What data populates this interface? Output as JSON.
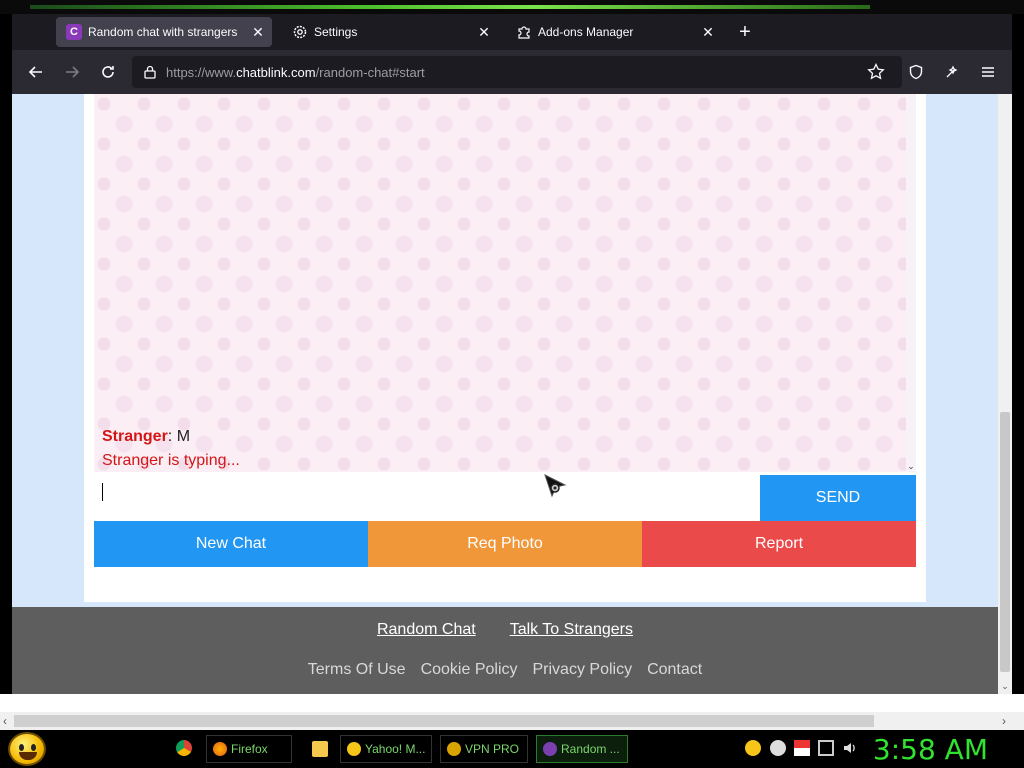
{
  "browser": {
    "tabs": [
      {
        "label": "Random chat with strangers",
        "favicon": "chatblink-favicon",
        "active": true
      },
      {
        "label": "Settings",
        "favicon": "gear-icon",
        "active": false
      },
      {
        "label": "Add-ons Manager",
        "favicon": "puzzle-icon",
        "active": false
      }
    ],
    "url_prefix": "https://www.",
    "url_domain": "chatblink.com",
    "url_path": "/random-chat#start"
  },
  "chat": {
    "message_sender": "Stranger",
    "message_text": ": M",
    "typing_status": "Stranger is typing...",
    "input_placeholder": "",
    "send_label": "SEND",
    "new_chat_label": "New Chat",
    "req_photo_label": "Req Photo",
    "report_label": "Report"
  },
  "footer": {
    "primary_links": [
      "Random Chat",
      "Talk To Strangers"
    ],
    "secondary_links": [
      "Terms Of Use",
      "Cookie Policy",
      "Privacy Policy",
      "Contact"
    ]
  },
  "taskbar": {
    "items": [
      {
        "label": "Firefox"
      },
      {
        "label": "Yahoo! M..."
      },
      {
        "label": "VPN PRO"
      },
      {
        "label": "Random ..."
      }
    ],
    "clock": "3:58 AM"
  },
  "colors": {
    "send": "#2196f3",
    "new_chat": "#2196f3",
    "req_photo": "#f0973a",
    "report": "#ea4a4a",
    "stranger_red": "#d41616",
    "footer_bg": "#5e5e5e",
    "clock_green": "#2fe32f"
  }
}
